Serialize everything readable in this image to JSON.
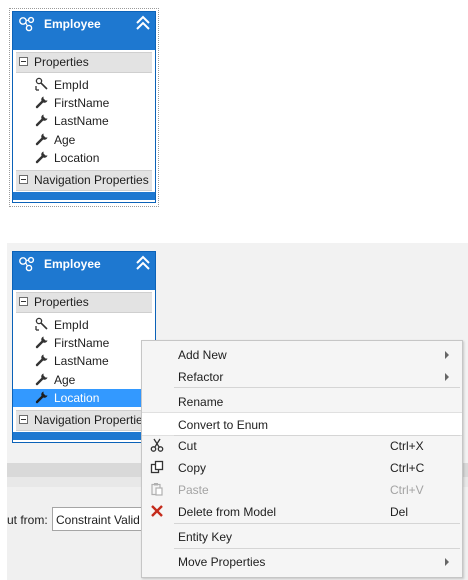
{
  "top_entity": {
    "title": "Employee",
    "properties_label": "Properties",
    "properties": [
      {
        "name": "EmpId",
        "icon": "key-wrench-icon"
      },
      {
        "name": "FirstName",
        "icon": "wrench-icon"
      },
      {
        "name": "LastName",
        "icon": "wrench-icon"
      },
      {
        "name": "Age",
        "icon": "wrench-icon"
      },
      {
        "name": "Location",
        "icon": "wrench-icon"
      }
    ],
    "nav_label": "Navigation Properties"
  },
  "bottom_entity": {
    "title": "Employee",
    "properties_label": "Properties",
    "properties": [
      {
        "name": "EmpId",
        "icon": "key-wrench-icon"
      },
      {
        "name": "FirstName",
        "icon": "wrench-icon"
      },
      {
        "name": "LastName",
        "icon": "wrench-icon"
      },
      {
        "name": "Age",
        "icon": "wrench-icon"
      },
      {
        "name": "Location",
        "icon": "wrench-icon",
        "selected": true
      }
    ],
    "nav_label": "Navigation Propertie"
  },
  "filter": {
    "label": "ut from:",
    "value": "Constraint Valid"
  },
  "context_menu": {
    "items": [
      {
        "label": "Add New",
        "submenu": true
      },
      {
        "label": "Refactor",
        "submenu": true
      },
      {
        "label": "Rename"
      },
      {
        "label": "Convert to Enum",
        "hover": true
      },
      {
        "label": "Cut",
        "shortcut": "Ctrl+X",
        "icon": "scissors-icon"
      },
      {
        "label": "Copy",
        "shortcut": "Ctrl+C",
        "icon": "copy-icon"
      },
      {
        "label": "Paste",
        "shortcut": "Ctrl+V",
        "icon": "paste-icon",
        "disabled": true
      },
      {
        "label": "Delete from Model",
        "shortcut": "Del",
        "icon": "delete-x-icon"
      },
      {
        "label": "Entity Key"
      },
      {
        "label": "Move Properties",
        "submenu": true
      }
    ]
  },
  "colors": {
    "entity_header": "#1e78d0",
    "selection": "#3399ff",
    "delete_icon": "#c42b1c"
  }
}
